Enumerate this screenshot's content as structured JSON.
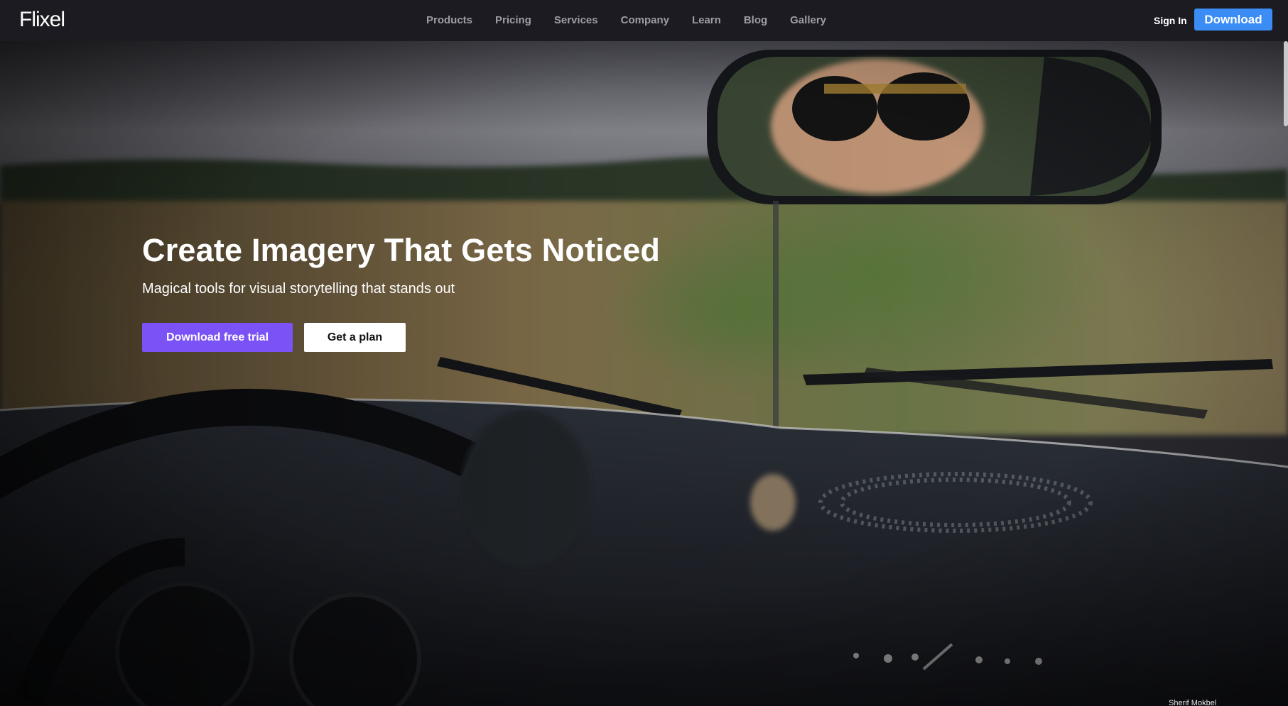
{
  "brand": {
    "logo_text": "Flixel"
  },
  "nav": {
    "links": [
      "Products",
      "Pricing",
      "Services",
      "Company",
      "Learn",
      "Blog",
      "Gallery"
    ],
    "signin_label": "Sign In",
    "download_label": "Download"
  },
  "hero": {
    "title": "Create Imagery That Gets Noticed",
    "subtitle": "Magical tools for visual storytelling that stands out",
    "primary_button": "Download free trial",
    "secondary_button": "Get a plan",
    "photo_credit": "Sherif Mokbel"
  },
  "colors": {
    "nav_background": "#1b1b21",
    "download_button": "#3b8cf5",
    "trial_button": "#7a52f5"
  }
}
